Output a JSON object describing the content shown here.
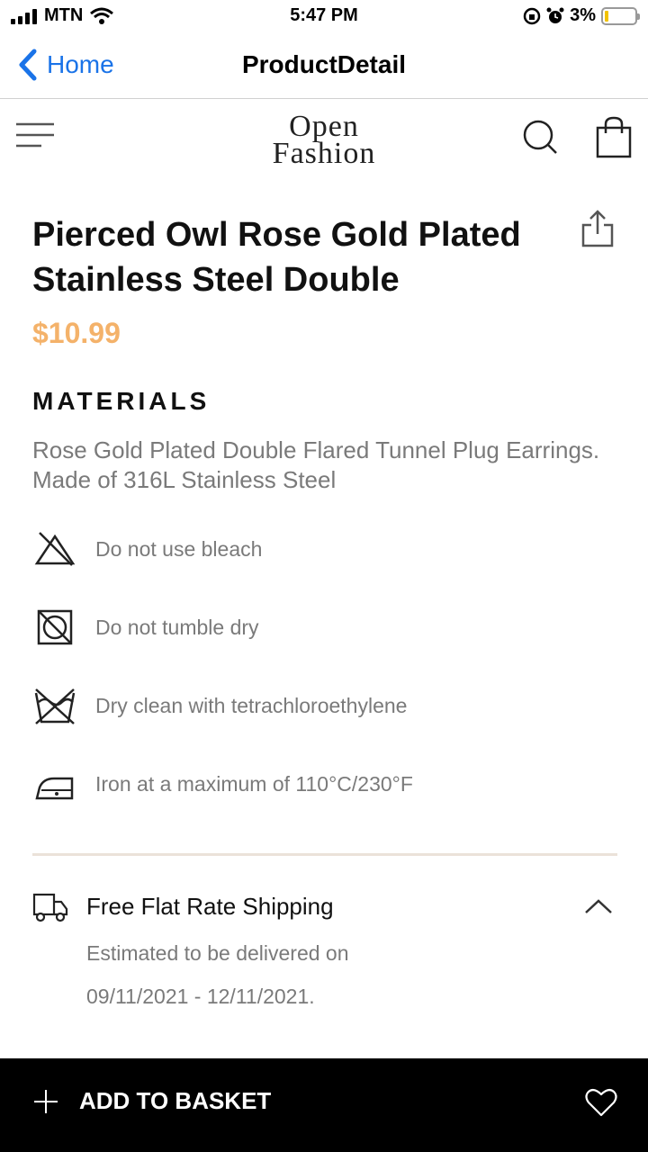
{
  "status_bar": {
    "carrier": "MTN",
    "time": "5:47 PM",
    "battery": "3%",
    "battery_level": 0.03
  },
  "nav": {
    "back_label": "Home",
    "title": "ProductDetail"
  },
  "header": {
    "logo_line1": "Open",
    "logo_line2": "Fashion"
  },
  "product": {
    "title": "Pierced Owl Rose Gold Plated Stainless Steel Double",
    "price": "$10.99",
    "price_color": "#f4b26a",
    "materials_heading": "MATERIALS",
    "materials_description": "Rose Gold Plated Double Flared Tunnel Plug Earrings. Made of 316L Stainless Steel"
  },
  "care": [
    {
      "icon": "no-bleach-icon",
      "label": "Do not use bleach"
    },
    {
      "icon": "no-tumble-dry-icon",
      "label": "Do not tumble dry"
    },
    {
      "icon": "dry-clean-icon",
      "label": "Dry clean with tetrachloroethylene"
    },
    {
      "icon": "iron-icon",
      "label": "Iron at a maximum of 110°C/230°F"
    }
  ],
  "shipping": {
    "title": "Free Flat Rate Shipping",
    "line1": "Estimated to be delivered on",
    "line2": "09/11/2021 - 12/11/2021."
  },
  "bottom": {
    "add_to_basket_label": "ADD TO BASKET"
  }
}
